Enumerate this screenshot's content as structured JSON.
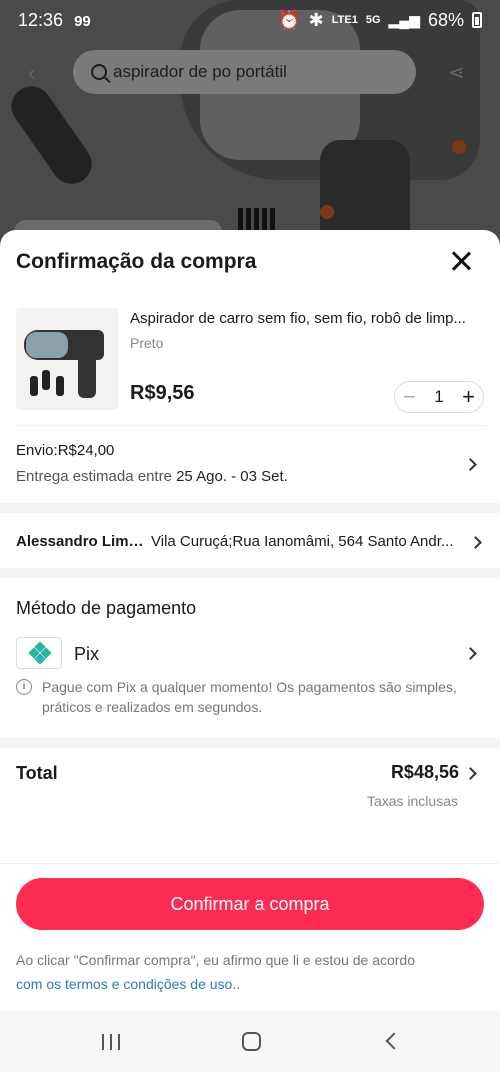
{
  "status_bar": {
    "time": "12:36",
    "notif": "99",
    "signal_label": "5G",
    "volte_label": "LTE1",
    "battery": "68%"
  },
  "search": {
    "query": "aspirador de po portátil"
  },
  "sheet": {
    "title": "Confirmação da compra"
  },
  "product": {
    "title": "Aspirador de carro sem fio, sem fio, robô de limp...",
    "variant": "Preto",
    "price": "R$9,56",
    "quantity": "1",
    "minus": "−",
    "plus": "+"
  },
  "shipping": {
    "label": "Envio:R$24,00",
    "estimate_prefix": "Entrega estimada entre ",
    "estimate_dates": "25 Ago. - 03 Set."
  },
  "address": {
    "name": "Alessandro Lima...",
    "line": "Vila Curuçá;Rua Ianomâmi, 564 Santo Andr..."
  },
  "payment": {
    "title": "Método de pagamento",
    "method": "Pix",
    "info": "Pague com Pix a qualquer momento! Os pagamentos são simples, práticos e realizados em segundos.",
    "info_icon": "i"
  },
  "total": {
    "label": "Total",
    "value": "R$48,56",
    "tax_note": "Taxas inclusas"
  },
  "confirm": {
    "button": "Confirmar a compra",
    "legal_text": "Ao clicar \"Confirmar compra\", eu afirmo que li e estou de acordo",
    "legal_link": "com os termos e condições de uso.."
  },
  "colors": {
    "accent": "#fe2c55",
    "link": "#2a7db5",
    "pix": "#2bb5a6"
  }
}
